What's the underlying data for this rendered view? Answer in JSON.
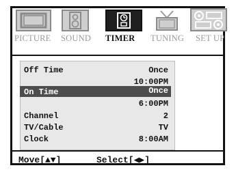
{
  "tabs": [
    {
      "label": "PICTURE",
      "icon": "tv-icon",
      "active": false
    },
    {
      "label": "SOUND",
      "icon": "speaker-icon",
      "active": false
    },
    {
      "label": "TIMER",
      "icon": "timer-clock-icon",
      "active": true
    },
    {
      "label": "TUNING",
      "icon": "antenna-tv-icon",
      "active": false
    },
    {
      "label": "SET UP",
      "icon": "setup-icon",
      "active": false
    }
  ],
  "menu": {
    "off_time_label": "Off Time",
    "off_time_mode": "Once",
    "off_time_value": "10:00PM",
    "on_time_label": "On Time",
    "on_time_mode": "Once",
    "on_time_value": "6:00PM",
    "channel_label": "Channel",
    "channel_value": "2",
    "tvcable_label": "TV/Cable",
    "tvcable_value": "TV",
    "clock_label": "Clock",
    "clock_value": "8:00AM"
  },
  "footer": {
    "move_label": "Move[▲▼]",
    "select_label": "Select[◀▶]"
  },
  "colors": {
    "highlight": "#4d4d4d",
    "panel": "#e8e8e8",
    "inactive_tab": "#cfcfcf",
    "active_tab": "#1f1f1f"
  }
}
